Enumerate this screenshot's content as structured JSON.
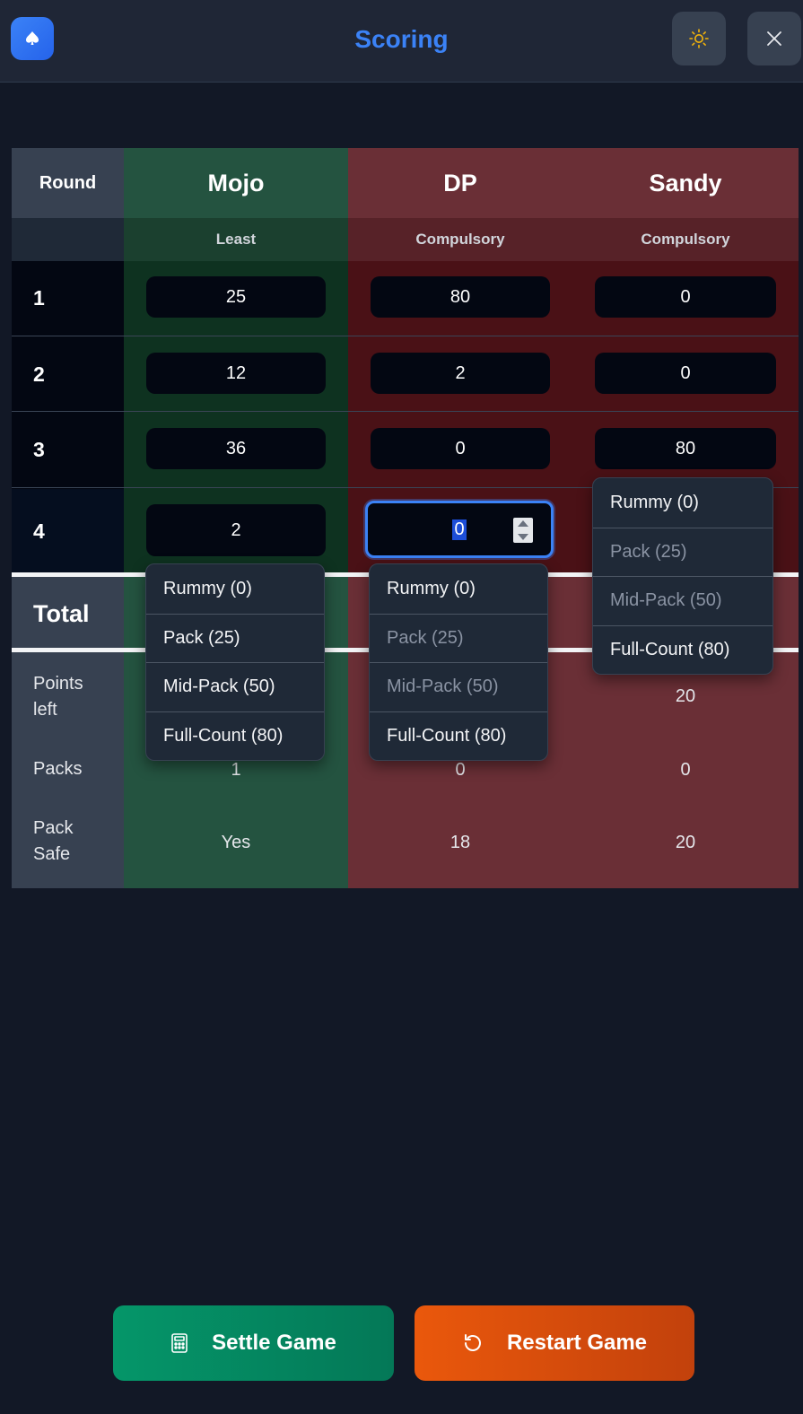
{
  "header": {
    "title": "Scoring",
    "logo_icon": "spade-icon",
    "theme_icon": "sun-icon",
    "close_icon": "close-icon"
  },
  "table": {
    "round_header": "Round",
    "players": [
      {
        "name": "Mojo",
        "type": "Least",
        "status": "green",
        "scores": [
          "25",
          "12",
          "36",
          "2"
        ],
        "points_left": "",
        "packs": "1",
        "pack_safe": "Yes"
      },
      {
        "name": "DP",
        "type": "Compulsory",
        "status": "red",
        "scores": [
          "80",
          "2",
          "0",
          "0"
        ],
        "points_left": "",
        "packs": "0",
        "pack_safe": "18"
      },
      {
        "name": "Sandy",
        "type": "Compulsory",
        "status": "red",
        "scores": [
          "0",
          "0",
          "80",
          ""
        ],
        "points_left": "20",
        "packs": "0",
        "pack_safe": "20"
      }
    ],
    "rounds": [
      "1",
      "2",
      "3",
      "4"
    ],
    "total_label": "Total",
    "footer_labels": {
      "points_left": "Points left",
      "packs": "Packs",
      "pack_safe": "Pack Safe"
    }
  },
  "dropdown_options": [
    "Rummy (0)",
    "Pack (25)",
    "Mid-Pack (50)",
    "Full-Count (80)"
  ],
  "buttons": {
    "settle": "Settle Game",
    "settle_icon": "calculator-icon",
    "restart": "Restart Game",
    "restart_icon": "rotate-ccw-icon"
  },
  "colors": {
    "accent": "#3b82f6",
    "settle": "#059669",
    "restart": "#ea580c"
  }
}
